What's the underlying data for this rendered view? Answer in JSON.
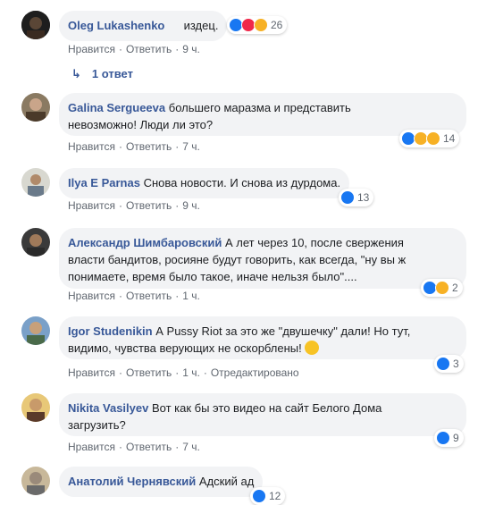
{
  "comments": [
    {
      "author": "Oleg Lukashenko",
      "text": "издец.",
      "actions": [
        "Нравится",
        "Ответить",
        "9 ч."
      ],
      "reactions": 26
    },
    {
      "author": "Galina Sergueeva",
      "text": "большего маразма и представить",
      "text2": "невозможно! Люди ли это?",
      "actions": [
        "Нравится",
        "Ответить",
        "7 ч."
      ],
      "reactions": 14
    },
    {
      "author": "Ilya E Parnas",
      "text": "Снова новости. И снова из дурдома.",
      "actions": [
        "Нравится",
        "Ответить",
        "9 ч."
      ],
      "reactions": 13
    },
    {
      "author": "Александр Шимбаровский",
      "text": "А лет через 10, после свержения",
      "text2": "власти бандитов, росияне будут говорить, как всегда, \"ну вы ж",
      "text3": "понимаете, время было такое, иначе нельзя было\"....",
      "actions": [
        "Нравится",
        "Ответить",
        "1 ч."
      ],
      "reactions": 2
    },
    {
      "author": "Igor Studenikin",
      "text": "А Pussy Riot за это же \"двушечку\" дали! Но тут,",
      "text2": "видимо, чувства верующих не оскорблены!",
      "actions": [
        "Нравится",
        "Ответить",
        "1 ч.",
        "Отредактировано"
      ],
      "reactions": 3
    },
    {
      "author": "Nikita Vasilyev",
      "text": "Вот как бы это видео на сайт Белого Дома",
      "text2": "загрузить?",
      "actions": [
        "Нравится",
        "Ответить",
        "7 ч."
      ],
      "reactions": 9
    },
    {
      "author": "Анатолий Чернявский",
      "text": "Адский ад",
      "reactions": 12
    }
  ],
  "reply": {
    "label": "1 ответ"
  }
}
